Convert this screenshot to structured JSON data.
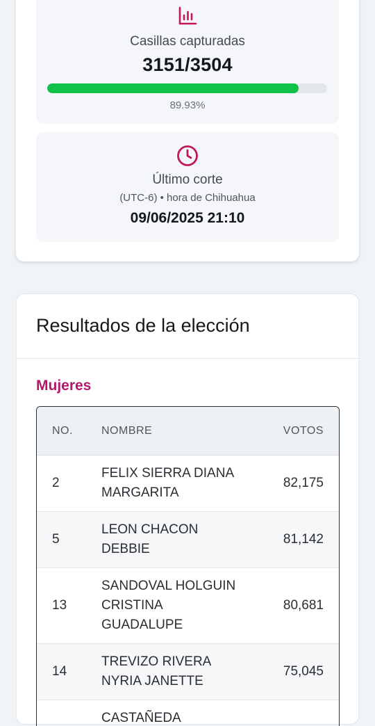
{
  "captured": {
    "label": "Casillas capturadas",
    "value": "3151/3504",
    "progress_percent": 89.93,
    "percent_text": "89.93%",
    "bar_color": "#10c24a",
    "icon": "bar-chart-icon"
  },
  "last_cut": {
    "label": "Último corte",
    "timezone": "(UTC-6) • hora de Chihuahua",
    "datetime": "09/06/2025 21:10",
    "icon": "clock-icon"
  },
  "results": {
    "title": "Resultados de la elección",
    "section": "Mujeres",
    "accent_color": "#b5166b",
    "columns": {
      "no": "NO.",
      "name": "NOMBRE",
      "votes": "VOTOS"
    },
    "rows": [
      {
        "no": "2",
        "name": "FELIX SIERRA DIANA MARGARITA",
        "votes": "82,175"
      },
      {
        "no": "5",
        "name": "LEON CHACON DEBBIE",
        "votes": "81,142"
      },
      {
        "no": "13",
        "name": "SANDOVAL HOLGUIN CRISTINA GUADALUPE",
        "votes": "80,681"
      },
      {
        "no": "14",
        "name": "TREVIZO RIVERA NYRIA JANETTE",
        "votes": "75,045"
      },
      {
        "no": "",
        "name": "CASTAÑEDA",
        "votes": ""
      }
    ]
  }
}
